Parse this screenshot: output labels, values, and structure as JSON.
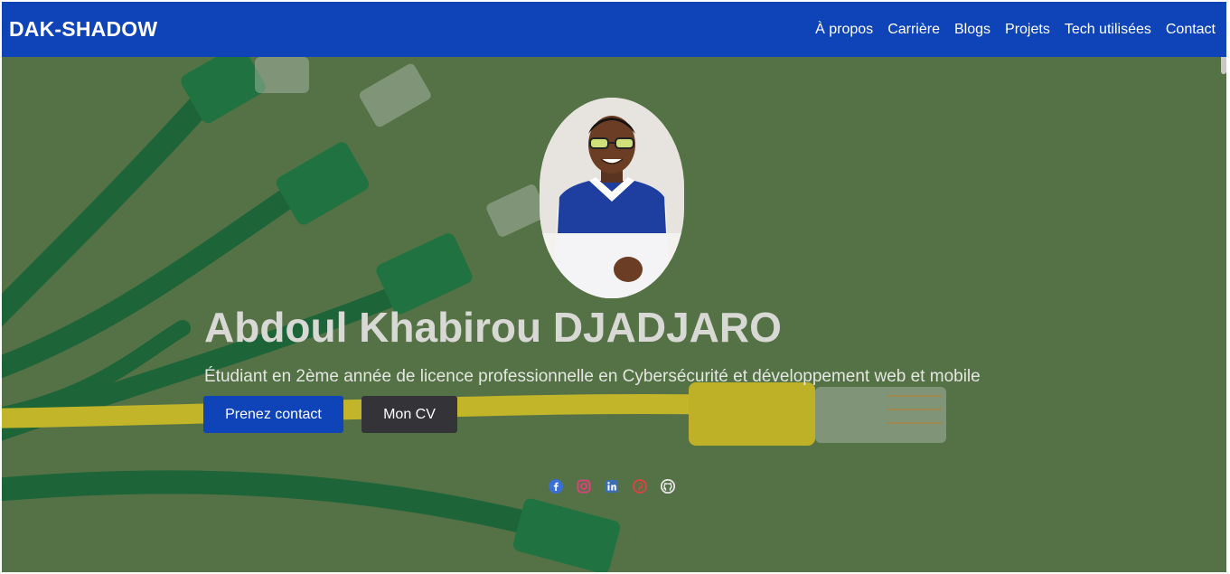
{
  "navbar": {
    "brand": "DAK-SHADOW",
    "links": [
      "À propos",
      "Carrière",
      "Blogs",
      "Projets",
      "Tech utilisées",
      "Contact"
    ]
  },
  "hero": {
    "name": "Abdoul Khabirou DJADJARO",
    "tagline": "Étudiant en 2ème année de licence professionnelle en Cybersécurité et développement web et mobile",
    "primary_button": "Prenez contact",
    "secondary_button": "Mon CV"
  },
  "socials": [
    {
      "icon": "facebook-icon",
      "color": "#3b6fd6"
    },
    {
      "icon": "instagram-icon",
      "color": "#d6457a"
    },
    {
      "icon": "linkedin-icon",
      "color": "#3b6fb0"
    },
    {
      "icon": "pinterest-icon",
      "color": "#d64545"
    },
    {
      "icon": "github-icon",
      "color": "#e8e8e8"
    }
  ],
  "colors": {
    "navbar": "#0f44b8",
    "hero_background": "#5b7a4c",
    "cable_green": "#1f7a45",
    "cable_yellow": "#d8c62b"
  }
}
